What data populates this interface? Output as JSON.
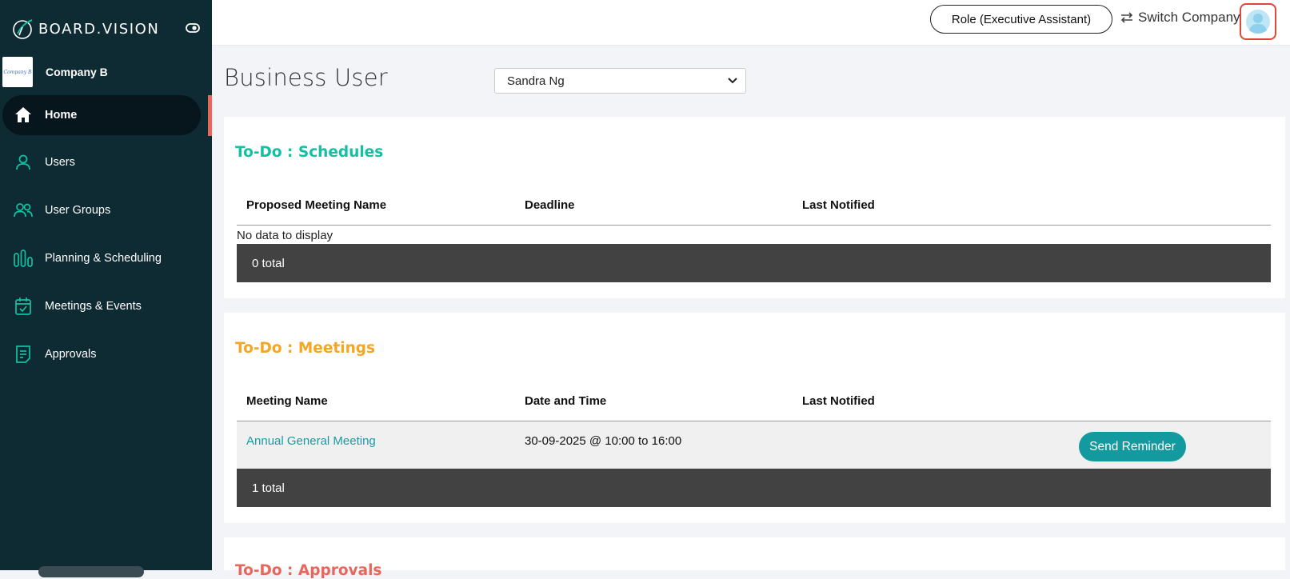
{
  "brand": {
    "name": "BOARD.VISION"
  },
  "company": {
    "logo_text": "Company B",
    "name": "Company B"
  },
  "sidebar": {
    "items": [
      {
        "label": "Home",
        "icon": "home-icon",
        "active": true
      },
      {
        "label": "Users",
        "icon": "user-icon"
      },
      {
        "label": "User Groups",
        "icon": "user-group-icon"
      },
      {
        "label": "Planning & Scheduling",
        "icon": "bar-chart-icon"
      },
      {
        "label": "Meetings & Events",
        "icon": "calendar-check-icon"
      },
      {
        "label": "Approvals",
        "icon": "document-icon"
      }
    ]
  },
  "topbar": {
    "role_label": "Role (Executive Assistant)",
    "switch_company_label": "Switch Company"
  },
  "page": {
    "title": "Business User",
    "selected_user": "Sandra Ng"
  },
  "colors": {
    "sidebar_bg": "#0e2a33",
    "teal": "#13c0a3",
    "orange": "#f5a623",
    "coral": "#e8665c",
    "button": "#139a9f"
  },
  "schedules": {
    "title": "To-Do : Schedules",
    "columns": [
      "Proposed Meeting Name",
      "Deadline",
      "Last Notified"
    ],
    "empty_text": "No data to display",
    "total": "0 total"
  },
  "meetings": {
    "title": "To-Do : Meetings",
    "columns": [
      "Meeting Name",
      "Date and Time",
      "Last Notified"
    ],
    "rows": [
      {
        "name": "Annual General Meeting",
        "datetime": "30-09-2025 @ 10:00 to 16:00",
        "last_notified": "",
        "action": "Send Reminder"
      }
    ],
    "total": "1 total"
  },
  "approvals": {
    "title": "To-Do : Approvals"
  }
}
